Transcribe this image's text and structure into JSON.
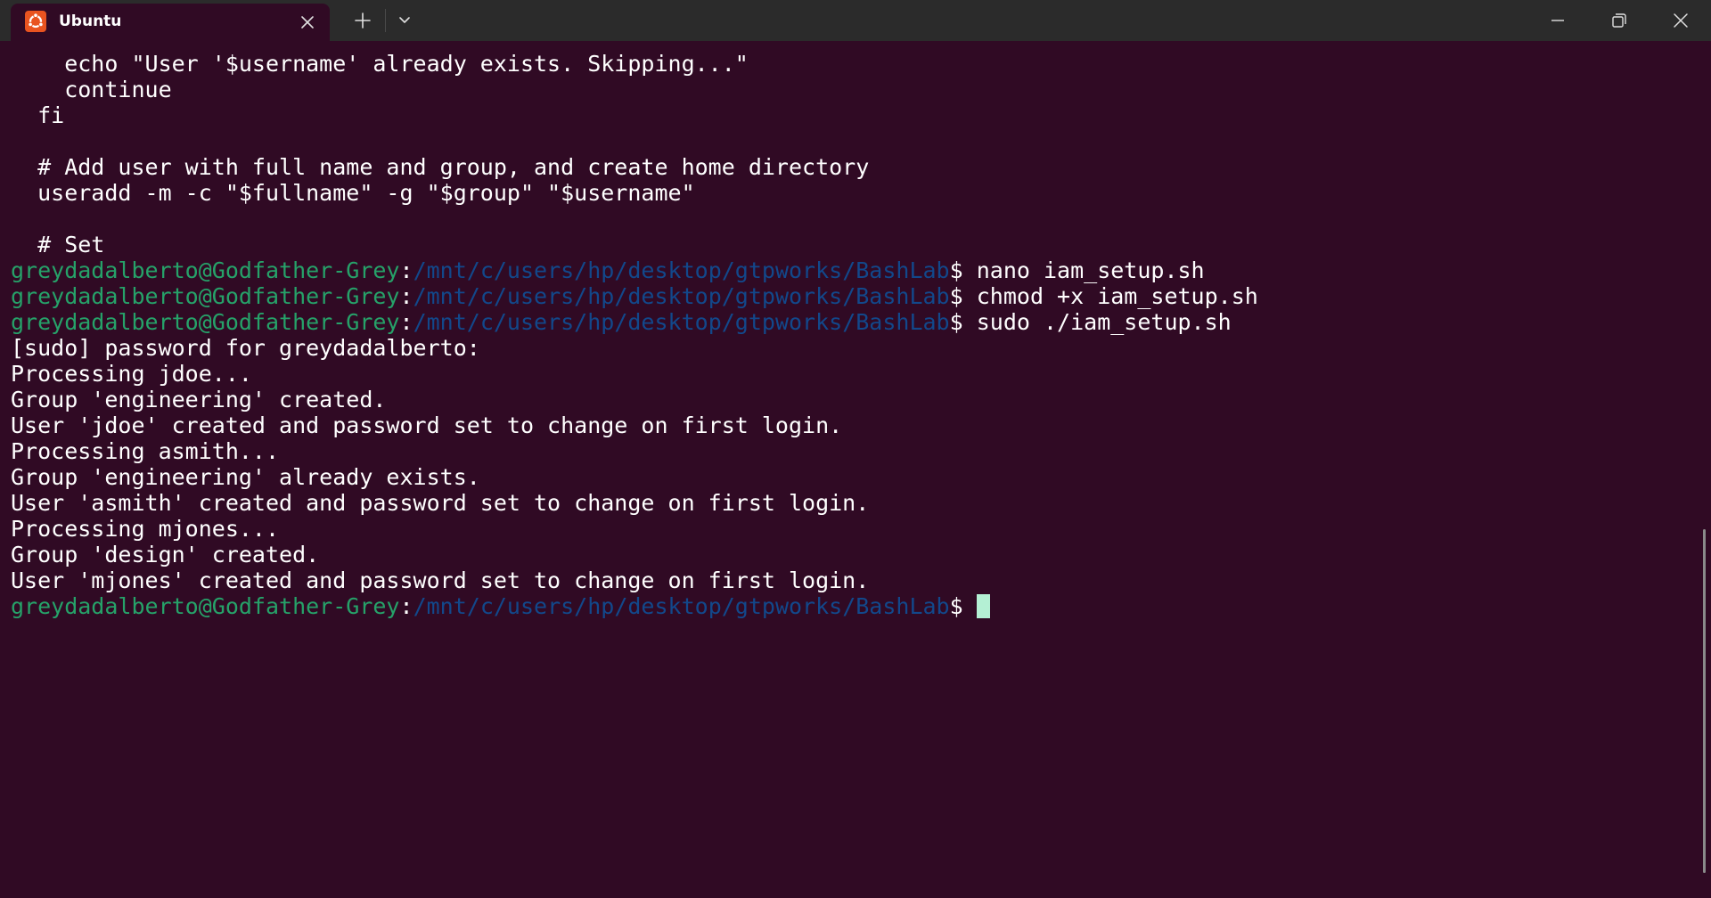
{
  "window": {
    "tab_title": "Ubuntu",
    "tab_icon": "ubuntu-logo-icon",
    "controls": [
      "new-tab-plus-icon",
      "dropdown-chevron-icon",
      "minimize-icon",
      "restore-icon",
      "close-icon"
    ]
  },
  "colors": {
    "background": "#300a24",
    "titlebar": "#2b2b2b",
    "prompt_user": "#26a269",
    "prompt_path": "#12488b",
    "text": "#ffffff",
    "cursor": "#b4f0d4",
    "ubuntu_orange": "#e95420"
  },
  "terminal": {
    "lines": [
      {
        "type": "text",
        "text": "    echo \"User '$username' already exists. Skipping...\""
      },
      {
        "type": "text",
        "text": "    continue"
      },
      {
        "type": "text",
        "text": "  fi"
      },
      {
        "type": "text",
        "text": ""
      },
      {
        "type": "text",
        "text": "  # Add user with full name and group, and create home directory"
      },
      {
        "type": "text",
        "text": "  useradd -m -c \"$fullname\" -g \"$group\" \"$username\""
      },
      {
        "type": "text",
        "text": ""
      },
      {
        "type": "text",
        "text": "  # Set"
      },
      {
        "type": "prompt",
        "user": "greydadalberto@Godfather-Grey",
        "sep": ":",
        "path": "/mnt/c/users/hp/desktop/gtpworks/BashLab",
        "symbol": "$",
        "command": " nano iam_setup.sh"
      },
      {
        "type": "prompt",
        "user": "greydadalberto@Godfather-Grey",
        "sep": ":",
        "path": "/mnt/c/users/hp/desktop/gtpworks/BashLab",
        "symbol": "$",
        "command": " chmod +x iam_setup.sh"
      },
      {
        "type": "prompt",
        "user": "greydadalberto@Godfather-Grey",
        "sep": ":",
        "path": "/mnt/c/users/hp/desktop/gtpworks/BashLab",
        "symbol": "$",
        "command": " sudo ./iam_setup.sh"
      },
      {
        "type": "text",
        "text": "[sudo] password for greydadalberto:"
      },
      {
        "type": "text",
        "text": "Processing jdoe..."
      },
      {
        "type": "text",
        "text": "Group 'engineering' created."
      },
      {
        "type": "text",
        "text": "User 'jdoe' created and password set to change on first login."
      },
      {
        "type": "text",
        "text": "Processing asmith..."
      },
      {
        "type": "text",
        "text": "Group 'engineering' already exists."
      },
      {
        "type": "text",
        "text": "User 'asmith' created and password set to change on first login."
      },
      {
        "type": "text",
        "text": "Processing mjones..."
      },
      {
        "type": "text",
        "text": "Group 'design' created."
      },
      {
        "type": "text",
        "text": "User 'mjones' created and password set to change on first login."
      },
      {
        "type": "prompt",
        "user": "greydadalberto@Godfather-Grey",
        "sep": ":",
        "path": "/mnt/c/users/hp/desktop/gtpworks/BashLab",
        "symbol": "$",
        "command": "",
        "cursor": true
      }
    ]
  }
}
